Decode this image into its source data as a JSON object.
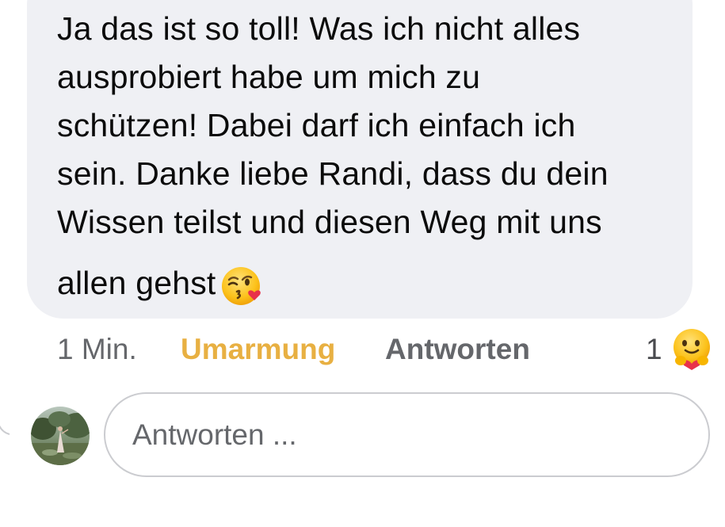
{
  "comment": {
    "lines": [
      "Ja das ist so toll! Was ich nicht alles",
      "ausprobiert habe um mich zu",
      "schützen! Dabei darf ich einfach ich",
      "sein. Danke liebe Randi, dass du dein",
      "Wissen teilst und diesen Weg mit uns",
      "allen gehst"
    ],
    "emoji": "face-blowing-a-kiss"
  },
  "meta": {
    "time": "1 Min.",
    "reaction_label": "Umarmung",
    "reply_label": "Antworten",
    "reaction_count": "1",
    "reaction_icon": "hugging-face-icon"
  },
  "reply": {
    "placeholder": "Antworten ..."
  },
  "colors": {
    "bubble": "#eff0f4",
    "reaction_accent": "#e8b042",
    "secondary_text": "#65676b"
  }
}
